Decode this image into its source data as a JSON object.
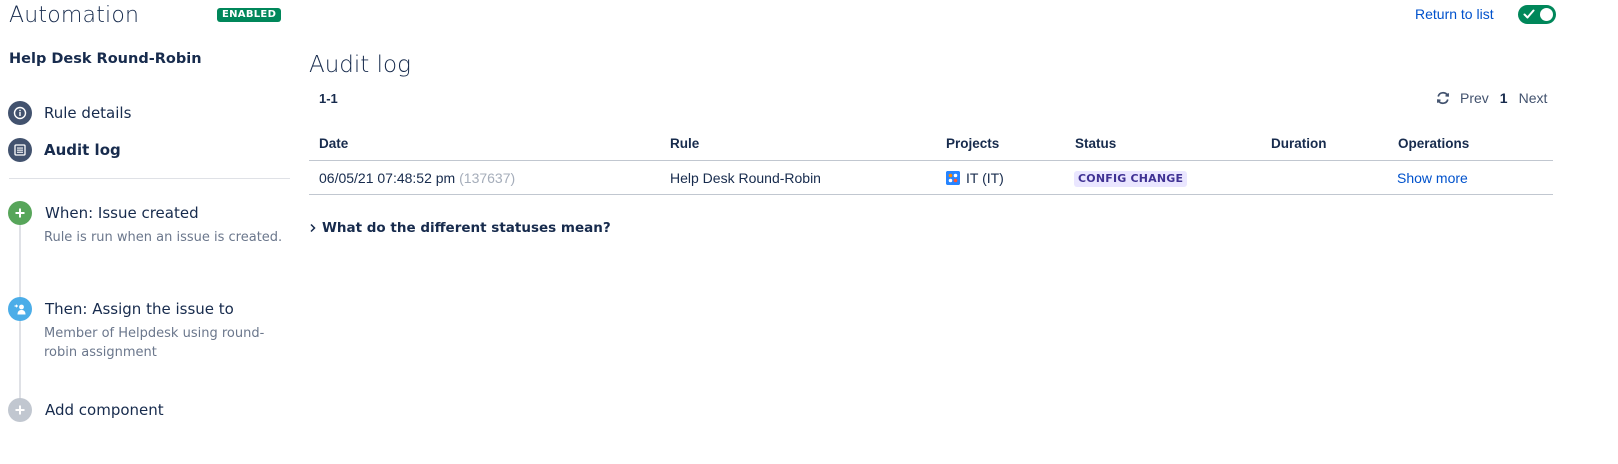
{
  "header": {
    "app_title": "Automation",
    "enabled_badge": "ENABLED",
    "return_link": "Return to list"
  },
  "sidebar": {
    "rule_name": "Help Desk Round-Robin",
    "nav": [
      {
        "label": "Rule details",
        "icon": "info-icon"
      },
      {
        "label": "Audit log",
        "icon": "list-icon"
      }
    ],
    "components": [
      {
        "title": "When: Issue created",
        "description": "Rule is run when an issue is created.",
        "icon": "plus-icon",
        "color": "#57a55a"
      },
      {
        "title": "Then: Assign the issue to",
        "description": "Member of Helpdesk using round-robin assignment",
        "icon": "assign-user-icon",
        "color": "#4bade8"
      },
      {
        "title": "Add component",
        "description": "",
        "icon": "plus-icon",
        "color": "#c1c7d0"
      }
    ]
  },
  "main": {
    "title": "Audit log",
    "range": "1-1",
    "pager": {
      "prev": "Prev",
      "current": "1",
      "next": "Next"
    },
    "columns": [
      "Date",
      "Rule",
      "Projects",
      "Status",
      "Duration",
      "Operations"
    ],
    "rows": [
      {
        "date": "06/05/21 07:48:52 pm",
        "exec_id": "(137637)",
        "rule": "Help Desk Round-Robin",
        "project": "IT (IT)",
        "status": "CONFIG CHANGE",
        "duration": "",
        "operation": "Show more"
      }
    ],
    "faq": "What do the different statuses mean?"
  },
  "colors": {
    "enabled": "#00875a",
    "link": "#0052cc",
    "status_lozenge_bg": "#eae6ff",
    "status_lozenge_text": "#403294"
  }
}
